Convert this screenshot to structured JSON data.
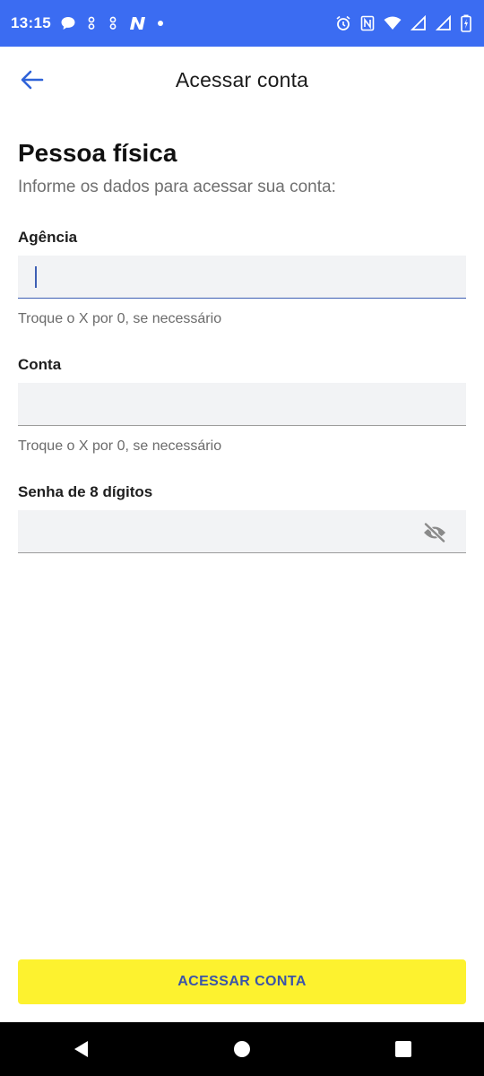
{
  "status_bar": {
    "time": "13:15",
    "background_color": "#3b6cf2",
    "left_icons": [
      "chat-bubble-icon",
      "app-notification-icon",
      "app-notification-icon",
      "n-app-icon",
      "dot-icon"
    ],
    "right_icons": [
      "alarm-icon",
      "nfc-icon",
      "wifi-icon",
      "signal-icon",
      "signal-icon",
      "battery-charging-icon"
    ]
  },
  "app_bar": {
    "title": "Acessar conta",
    "back_icon": "arrow-left-icon",
    "accent_color": "#2f63d8"
  },
  "content": {
    "title": "Pessoa física",
    "subtitle": "Informe os dados para acessar sua conta:"
  },
  "fields": {
    "agencia": {
      "label": "Agência",
      "value": "",
      "hint": "Troque o X por 0, se necessário"
    },
    "conta": {
      "label": "Conta",
      "value": "",
      "hint": "Troque o X por 0, se necessário"
    },
    "senha": {
      "label": "Senha de 8 dígitos",
      "value": "",
      "toggle_icon": "eye-off-icon"
    }
  },
  "primary_button": {
    "label": "ACESSAR CONTA",
    "background_color": "#fdf22f",
    "text_color": "#3b54a8"
  },
  "nav_bar": {
    "buttons": [
      "back-triangle-icon",
      "home-circle-icon",
      "recents-square-icon"
    ]
  }
}
